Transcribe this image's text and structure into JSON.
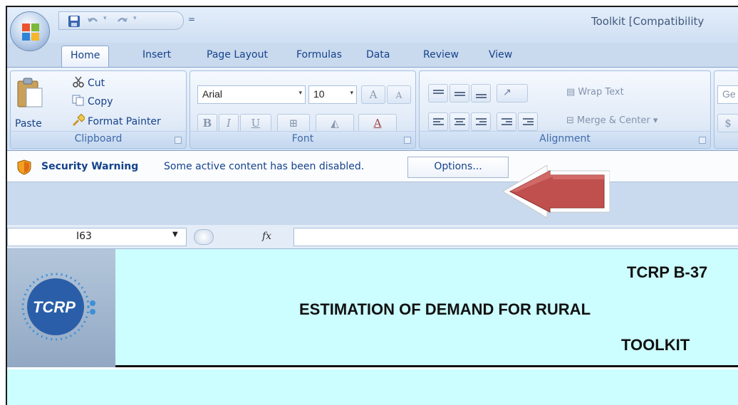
{
  "window": {
    "title": "Toolkit  [Compatibility"
  },
  "quick_access": {
    "save_icon": "save-icon",
    "undo_icon": "undo-icon",
    "redo_icon": "redo-icon",
    "customize_glyph": "="
  },
  "tabs": [
    {
      "label": "Home",
      "active": true
    },
    {
      "label": "Insert"
    },
    {
      "label": "Page Layout"
    },
    {
      "label": "Formulas"
    },
    {
      "label": "Data"
    },
    {
      "label": "Review"
    },
    {
      "label": "View"
    }
  ],
  "ribbon": {
    "clipboard": {
      "label": "Clipboard",
      "paste": "Paste",
      "cut": "Cut",
      "copy": "Copy",
      "format_painter": "Format Painter"
    },
    "font": {
      "label": "Font",
      "font_name": "Arial",
      "font_size": "10",
      "grow": "A",
      "shrink": "A",
      "bold": "B",
      "italic": "I",
      "underline": "U",
      "font_color": "A"
    },
    "alignment": {
      "label": "Alignment",
      "wrap_text": "Wrap Text",
      "merge_center": "Merge & Center"
    },
    "number": {
      "format": "Ge",
      "currency": "$"
    }
  },
  "security": {
    "title": "Security Warning",
    "message": "Some active content has been disabled.",
    "options_label": "Options..."
  },
  "formula_bar": {
    "name_box": "I63",
    "fx": "fx",
    "value": ""
  },
  "sheet": {
    "logo_text": "TCRP",
    "line1": "TCRP B-37",
    "line2": "ESTIMATION OF DEMAND FOR RURAL",
    "line3": "TOOLKIT"
  },
  "colors": {
    "banner_bg": "#ccfdff",
    "arrow": "#c0504d",
    "ribbon_text": "#15428b"
  }
}
